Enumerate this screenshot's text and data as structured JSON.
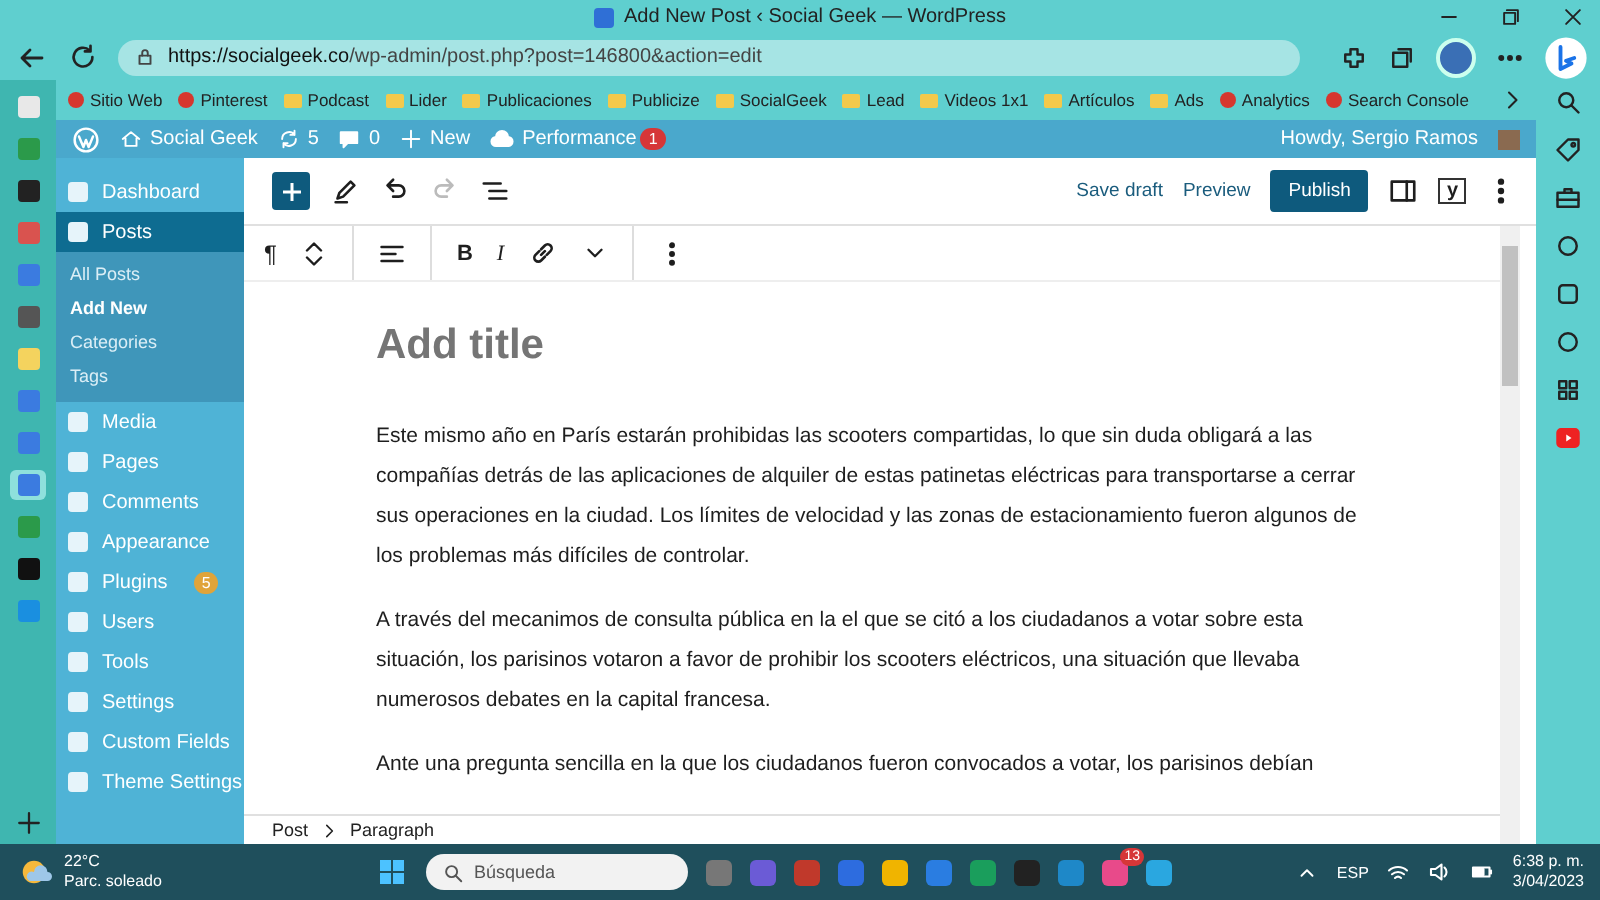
{
  "browser": {
    "title": "Add New Post ‹ Social Geek — WordPress",
    "url_host": "https://socialgeek.co",
    "url_path": "/wp-admin/post.php?post=146800&action=edit",
    "bookmarks": [
      {
        "label": "Sitio Web",
        "kind": "site"
      },
      {
        "label": "Pinterest",
        "kind": "site"
      },
      {
        "label": "Podcast",
        "kind": "folder"
      },
      {
        "label": "Lider",
        "kind": "folder"
      },
      {
        "label": "Publicaciones",
        "kind": "folder"
      },
      {
        "label": "Publicize",
        "kind": "folder"
      },
      {
        "label": "SocialGeek",
        "kind": "folder"
      },
      {
        "label": "Lead",
        "kind": "folder"
      },
      {
        "label": "Videos 1x1",
        "kind": "folder"
      },
      {
        "label": "Artículos",
        "kind": "folder"
      },
      {
        "label": "Ads",
        "kind": "folder"
      },
      {
        "label": "Analytics",
        "kind": "site"
      },
      {
        "label": "Search Console",
        "kind": "site"
      }
    ]
  },
  "admin_bar": {
    "site": "Social Geek",
    "updates": "5",
    "comments": "0",
    "new": "New",
    "performance": "Performance",
    "performance_badge": "1",
    "howdy": "Howdy, Sergio Ramos"
  },
  "admin_menu": [
    {
      "label": "Dashboard",
      "selected": false
    },
    {
      "label": "Posts",
      "selected": true,
      "children": [
        {
          "label": "All Posts",
          "selected": false
        },
        {
          "label": "Add New",
          "selected": true
        },
        {
          "label": "Categories",
          "selected": false
        },
        {
          "label": "Tags",
          "selected": false
        }
      ]
    },
    {
      "label": "Media",
      "selected": false
    },
    {
      "label": "Pages",
      "selected": false
    },
    {
      "label": "Comments",
      "selected": false
    },
    {
      "label": "Appearance",
      "selected": false
    },
    {
      "label": "Plugins",
      "selected": false,
      "badge": "5"
    },
    {
      "label": "Users",
      "selected": false
    },
    {
      "label": "Tools",
      "selected": false
    },
    {
      "label": "Settings",
      "selected": false
    },
    {
      "label": "Custom Fields",
      "selected": false
    },
    {
      "label": "Theme Settings",
      "selected": false
    }
  ],
  "editor": {
    "save_draft": "Save draft",
    "preview": "Preview",
    "publish": "Publish",
    "seo_logo": "y",
    "paragraph_glyph": "¶",
    "bold": "B",
    "italic": "I",
    "title_placeholder": "Add title",
    "paragraphs": [
      "Este mismo año en París estarán prohibidas las scooters compartidas, lo que sin duda obligará a las compañías detrás de las aplicaciones de alquiler de estas patinetas eléctricas para transportarse a cerrar sus operaciones en la ciudad. Los límites de velocidad y las zonas de estacionamiento fueron algunos de los problemas más difíciles de controlar.",
      "A través del mecanimos de consulta pública en la el que se citó a los ciudadanos a votar sobre esta situación, los parisinos votaron a favor de prohibir los scooters eléctricos, una situación que llevaba numerosos debates en la capital francesa.",
      "Ante una pregunta sencilla en la que los ciudadanos fueron convocados a votar, los parisinos debían"
    ],
    "breadcrumb": [
      "Post",
      "Paragraph"
    ]
  },
  "taskbar": {
    "temperature": "22°C",
    "weather": "Parc. soleado",
    "search_placeholder": "Búsqueda",
    "chat_badge": "13",
    "language": "ESP",
    "time": "6:38 p. m.",
    "date": "3/04/2023"
  }
}
